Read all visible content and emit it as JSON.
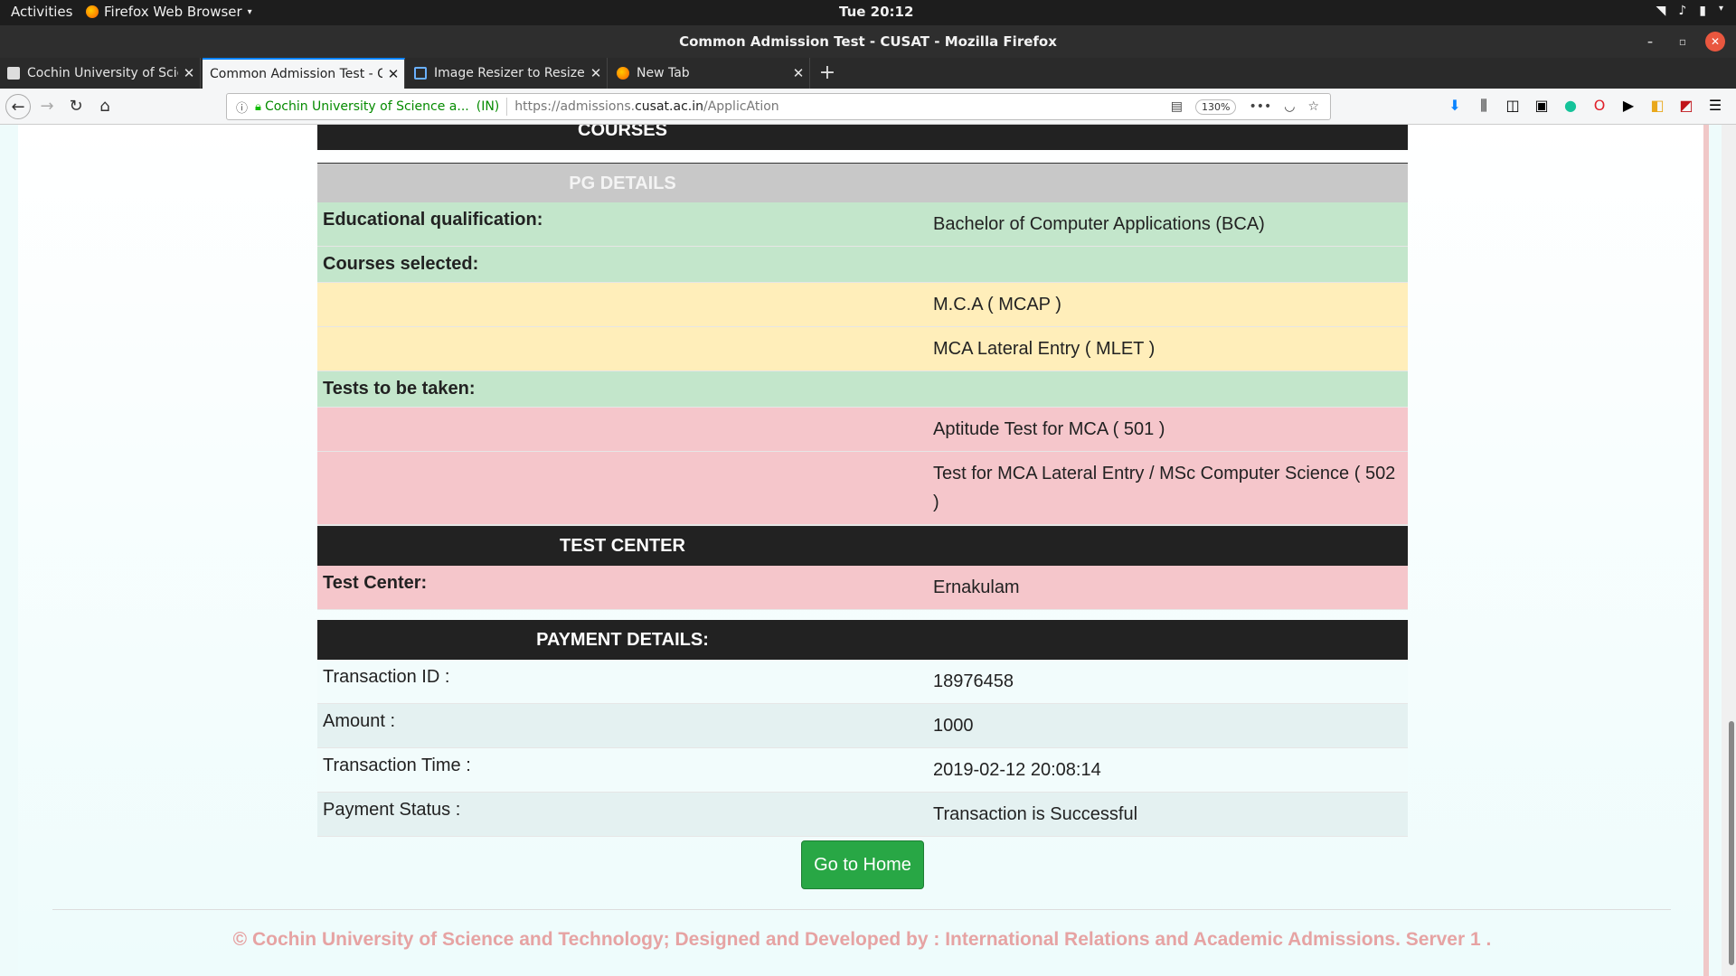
{
  "os": {
    "activities": "Activities",
    "app_name": "Firefox Web Browser",
    "clock": "Tue 20:12"
  },
  "window": {
    "title": "Common Admission Test - CUSAT - Mozilla Firefox"
  },
  "tabs": [
    {
      "label": "Cochin University of Scie"
    },
    {
      "label": "Common Admission Test - C"
    },
    {
      "label": "Image Resizer to Resize a"
    },
    {
      "label": "New Tab"
    }
  ],
  "navbar": {
    "site_identity": "Cochin University of Science a...",
    "country": "(IN)",
    "url_prefix": "https://admissions.",
    "url_domain": "cusat.ac.in",
    "url_path": "/ApplicAtion",
    "zoom": "130%"
  },
  "courses": {
    "header": "COURSES",
    "pg_header": "PG DETAILS",
    "qualification_label": "Educational qualification:",
    "qualification_value": "Bachelor of Computer Applications (BCA)",
    "courses_label": "Courses selected:",
    "courses": [
      "M.C.A ( MCAP )",
      "MCA Lateral Entry ( MLET )"
    ],
    "tests_label": "Tests to be taken:",
    "tests": [
      "Aptitude Test for MCA ( 501 )",
      "Test for MCA Lateral Entry / MSc Computer Science ( 502 )"
    ]
  },
  "test_center": {
    "header": "TEST CENTER",
    "label": "Test Center:",
    "value": "Ernakulam"
  },
  "payment": {
    "header": "PAYMENT DETAILS:",
    "rows": [
      {
        "label": "Transaction ID :",
        "value": "18976458"
      },
      {
        "label": "Amount :",
        "value": "1000"
      },
      {
        "label": "Transaction Time :",
        "value": "2019-02-12 20:08:14"
      },
      {
        "label": "Payment Status :",
        "value": "Transaction is Successful"
      }
    ]
  },
  "home_button": "Go to Home",
  "footer": "© Cochin University of Science and Technology; Designed and Developed by : International Relations and Academic Admissions. Server 1 ."
}
